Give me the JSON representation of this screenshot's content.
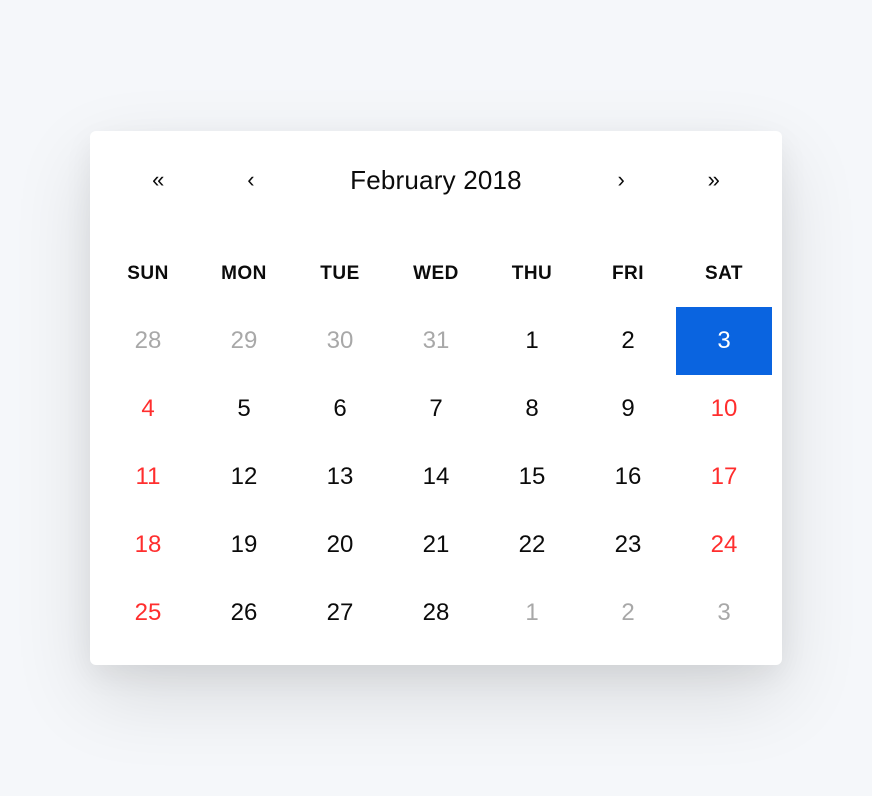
{
  "header": {
    "prev_year_glyph": "«",
    "prev_month_glyph": "‹",
    "title": "February 2018",
    "next_month_glyph": "›",
    "next_year_glyph": "»"
  },
  "weekdays": [
    "SUN",
    "MON",
    "TUE",
    "WED",
    "THU",
    "FRI",
    "SAT"
  ],
  "days": [
    {
      "n": "28",
      "other": true
    },
    {
      "n": "29",
      "other": true
    },
    {
      "n": "30",
      "other": true
    },
    {
      "n": "31",
      "other": true
    },
    {
      "n": "1"
    },
    {
      "n": "2"
    },
    {
      "n": "3",
      "selected": true
    },
    {
      "n": "4",
      "weekend": true
    },
    {
      "n": "5"
    },
    {
      "n": "6"
    },
    {
      "n": "7"
    },
    {
      "n": "8"
    },
    {
      "n": "9"
    },
    {
      "n": "10",
      "weekend": true
    },
    {
      "n": "11",
      "weekend": true
    },
    {
      "n": "12"
    },
    {
      "n": "13"
    },
    {
      "n": "14"
    },
    {
      "n": "15"
    },
    {
      "n": "16"
    },
    {
      "n": "17",
      "weekend": true
    },
    {
      "n": "18",
      "weekend": true
    },
    {
      "n": "19"
    },
    {
      "n": "20"
    },
    {
      "n": "21"
    },
    {
      "n": "22"
    },
    {
      "n": "23"
    },
    {
      "n": "24",
      "weekend": true
    },
    {
      "n": "25",
      "weekend": true
    },
    {
      "n": "26"
    },
    {
      "n": "27"
    },
    {
      "n": "28"
    },
    {
      "n": "1",
      "other": true
    },
    {
      "n": "2",
      "other": true
    },
    {
      "n": "3",
      "other": true
    }
  ]
}
